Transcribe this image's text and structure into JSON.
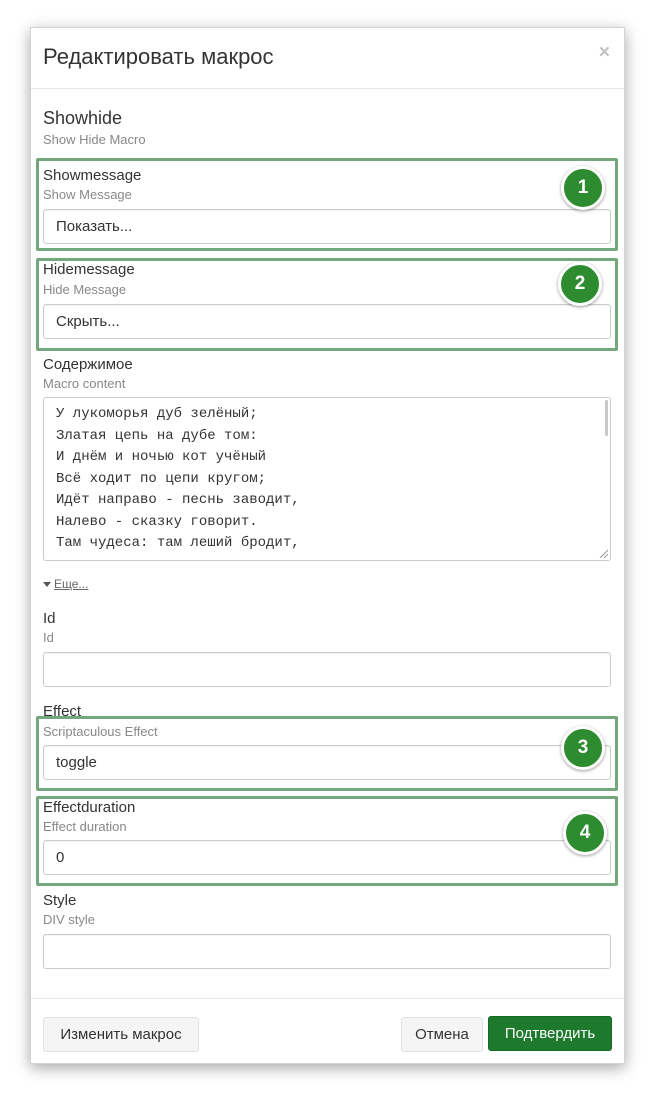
{
  "dialog": {
    "title": "Редактировать макрос",
    "close_symbol": "×",
    "macro_name": "Showhide",
    "macro_description": "Show Hide Macro"
  },
  "fields": {
    "showmessage": {
      "label": "Showmessage",
      "description": "Show Message",
      "value": "Показать..."
    },
    "hidemessage": {
      "label": "Hidemessage",
      "description": "Hide Message",
      "value": "Скрыть..."
    },
    "content": {
      "label": "Содержимое",
      "description": "Macro content",
      "lines": [
        "У лукоморья дуб зелёный;",
        "Златая цепь на дубе том:",
        "И днём и ночью кот учёный",
        "Всё ходит по цепи кругом;",
        "Идёт направо - песнь заводит,",
        "Налево - сказку говорит.",
        "Там чудеса: там леший бродит,"
      ]
    },
    "more_link": "Еще...",
    "id": {
      "label": "Id",
      "description": "Id",
      "value": ""
    },
    "effect": {
      "label": "Effect",
      "description": "Scriptaculous Effect",
      "value": "toggle"
    },
    "effectduration": {
      "label": "Effectduration",
      "description": "Effect duration",
      "value": "0"
    },
    "style": {
      "label": "Style",
      "description": "DIV style",
      "value": ""
    }
  },
  "annotations": {
    "colors": {
      "highlight_border": "#74a77c",
      "badge_fill": "#2d8c2f"
    },
    "badges": [
      "1",
      "2",
      "3",
      "4"
    ]
  },
  "footer": {
    "change_macro": "Изменить макрос",
    "cancel": "Отмена",
    "confirm": "Подтвердить"
  },
  "colors": {
    "primary": "#1d7a2d"
  }
}
